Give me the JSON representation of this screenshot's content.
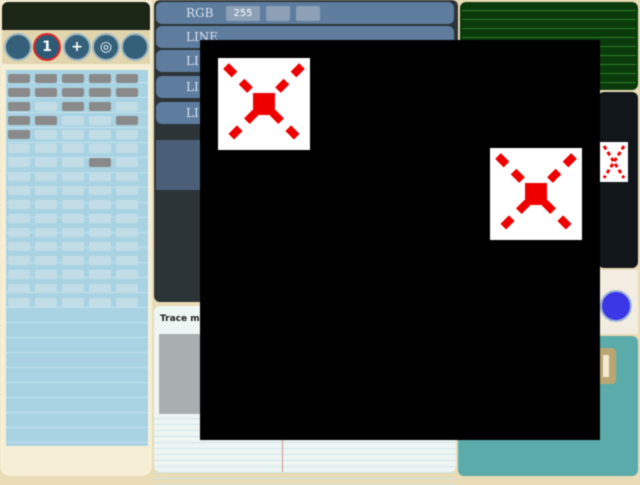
{
  "colors": {
    "overlay": "#000000",
    "accent_red": "#e0272c",
    "bar_blue": "#5e7c9e",
    "left_list": "#a9d3e3",
    "right_green": "#0b3a0b",
    "right_teal": "#5aaba9",
    "blue_dot": "#3b36e6"
  },
  "toolbar": {
    "buttons": [
      {
        "icon": "circle-icon",
        "glyph": ""
      },
      {
        "icon": "number-one-icon",
        "glyph": "1"
      },
      {
        "icon": "plus-icon",
        "glyph": "+"
      },
      {
        "icon": "target-icon",
        "glyph": "◎"
      },
      {
        "icon": "circle-icon",
        "glyph": ""
      }
    ]
  },
  "color_panel": {
    "rgb_label": "RGB",
    "rgb_value": "255",
    "line_labels": [
      "LINE",
      "LI",
      "LI",
      "LI"
    ]
  },
  "bottom_panel": {
    "title": "Trace m"
  },
  "overlay": {
    "placeholders": [
      "broken-image-icon",
      "broken-image-icon",
      "broken-image-icon"
    ]
  }
}
